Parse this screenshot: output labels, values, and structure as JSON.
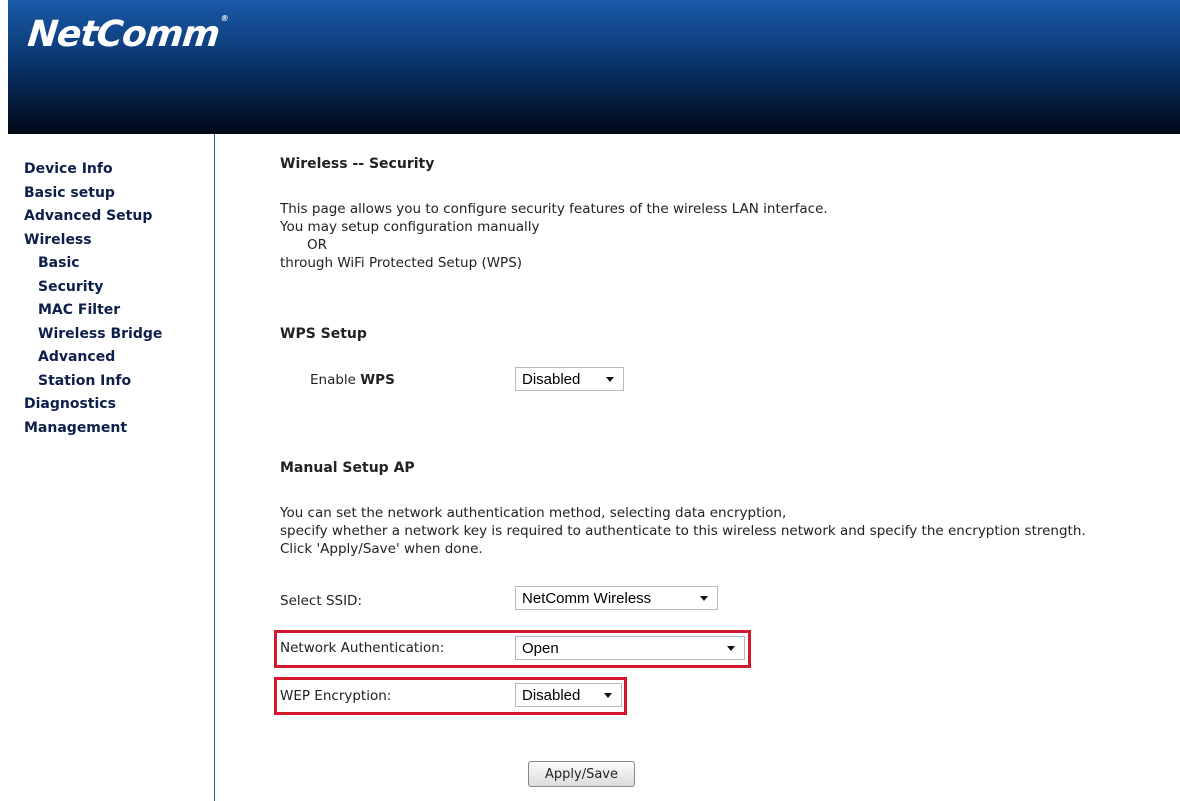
{
  "brand": {
    "logo_text": "NetComm",
    "trademark": "®"
  },
  "sidebar": {
    "items": [
      {
        "label": "Device Info",
        "level": 0
      },
      {
        "label": "Basic setup",
        "level": 0
      },
      {
        "label": "Advanced Setup",
        "level": 0
      },
      {
        "label": "Wireless",
        "level": 0
      },
      {
        "label": "Basic",
        "level": 1
      },
      {
        "label": "Security",
        "level": 1
      },
      {
        "label": "MAC Filter",
        "level": 1
      },
      {
        "label": "Wireless Bridge",
        "level": 1
      },
      {
        "label": "Advanced",
        "level": 1
      },
      {
        "label": "Station Info",
        "level": 1
      },
      {
        "label": "Diagnostics",
        "level": 0
      },
      {
        "label": "Management",
        "level": 0
      }
    ]
  },
  "main": {
    "title": "Wireless -- Security",
    "intro": {
      "line1": "This page allows you to configure security features of the wireless LAN interface.",
      "line2": "You may setup configuration manually",
      "or": "OR",
      "line3": "through WiFi Protected Setup (WPS)"
    },
    "wps": {
      "heading": "WPS Setup",
      "enable_label_prefix": "Enable",
      "enable_label_bold": "WPS",
      "enable_value": "Disabled"
    },
    "manual": {
      "heading": "Manual Setup AP",
      "desc1": "You can set the network authentication method, selecting data encryption,",
      "desc2": "specify whether a network key is required to authenticate to this wireless network and specify the encryption strength.",
      "desc3": "Click 'Apply/Save' when done.",
      "ssid_label": "Select SSID:",
      "ssid_value": "NetComm Wireless",
      "auth_label": "Network Authentication:",
      "auth_value": "Open",
      "wep_label": "WEP Encryption:",
      "wep_value": "Disabled"
    },
    "apply_button": "Apply/Save"
  },
  "colors": {
    "highlight": "#d2182d",
    "header_top": "#1a5aa8",
    "header_bottom": "#010814",
    "nav_text": "#0d1f4a"
  }
}
